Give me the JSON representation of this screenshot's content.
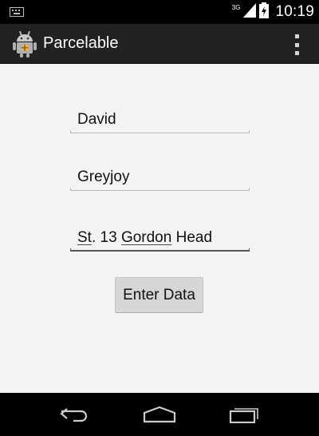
{
  "status_bar": {
    "network_type": "3G",
    "time": "10:19",
    "icons": [
      "notification-icon",
      "signal-icon",
      "battery-icon"
    ]
  },
  "action_bar": {
    "title": "Parcelable",
    "app_icon": "android-app-icon",
    "overflow_icon": "overflow-menu-icon"
  },
  "form": {
    "fields": [
      {
        "value": "David",
        "focused": false
      },
      {
        "value": "Greyjoy",
        "focused": false
      },
      {
        "value": "St. 13 Gordon Head",
        "value_parts": [
          "St",
          ". 13 ",
          "Gordon",
          " Head"
        ],
        "focused": true
      }
    ],
    "submit_label": "Enter Data"
  },
  "nav_bar": {
    "buttons": [
      "back-icon",
      "home-icon",
      "recent-apps-icon"
    ]
  },
  "colors": {
    "status_bar_bg": "#000000",
    "action_bar_bg": "#222222",
    "content_bg": "#f3f3f3",
    "button_bg": "#d6d6d6"
  }
}
